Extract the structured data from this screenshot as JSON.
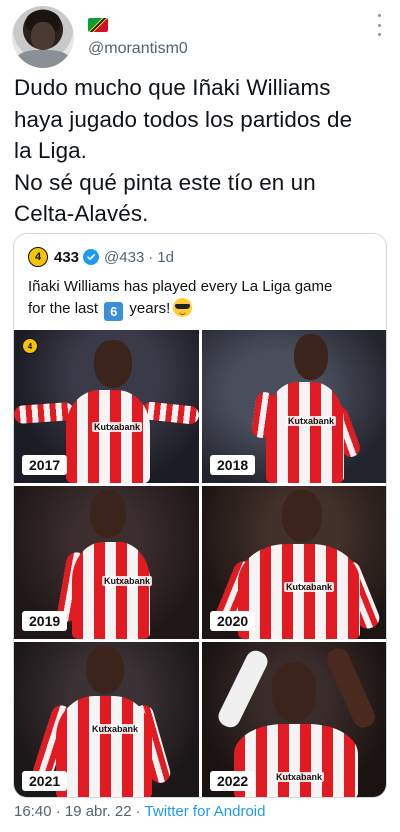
{
  "author": {
    "handle": "@morantism0",
    "avatar_icon": "avatar-photo",
    "flag_icon": "saint-kitts-and-nevis-flag-icon"
  },
  "tweet": {
    "lines": [
      "Dudo mucho que Iñaki Williams",
      "haya jugado todos los partidos de",
      "la Liga.",
      "No sé qué pinta este tío en un",
      "Celta-Alavés."
    ],
    "timestamp": "16:40 · 19 abr. 22",
    "separator": "·",
    "source": "Twitter for Android"
  },
  "quoted": {
    "logo_text": "4",
    "name": "433",
    "handle": "@433",
    "separator": "·",
    "time": "1d",
    "text_line1": "Iñaki Williams has played every La Liga game",
    "text_line2_pre": "for the last",
    "text_line2_num": "6",
    "text_line2_post": "years!",
    "emoji_icon": "sunglasses-emoji-icon",
    "photos": [
      {
        "year": "2017",
        "sponsor": "Kutxabank"
      },
      {
        "year": "2018",
        "sponsor": "Kutxabank"
      },
      {
        "year": "2019",
        "sponsor": "Kutxabank"
      },
      {
        "year": "2020",
        "sponsor": "Kutxabank"
      },
      {
        "year": "2021",
        "sponsor": "Kutxabank"
      },
      {
        "year": "2022",
        "sponsor": "Kutxabank"
      }
    ]
  },
  "colors": {
    "accent": "#1d9bf0",
    "muted": "#536471",
    "border": "#cfd9de",
    "kit_red": "#e21b23"
  }
}
